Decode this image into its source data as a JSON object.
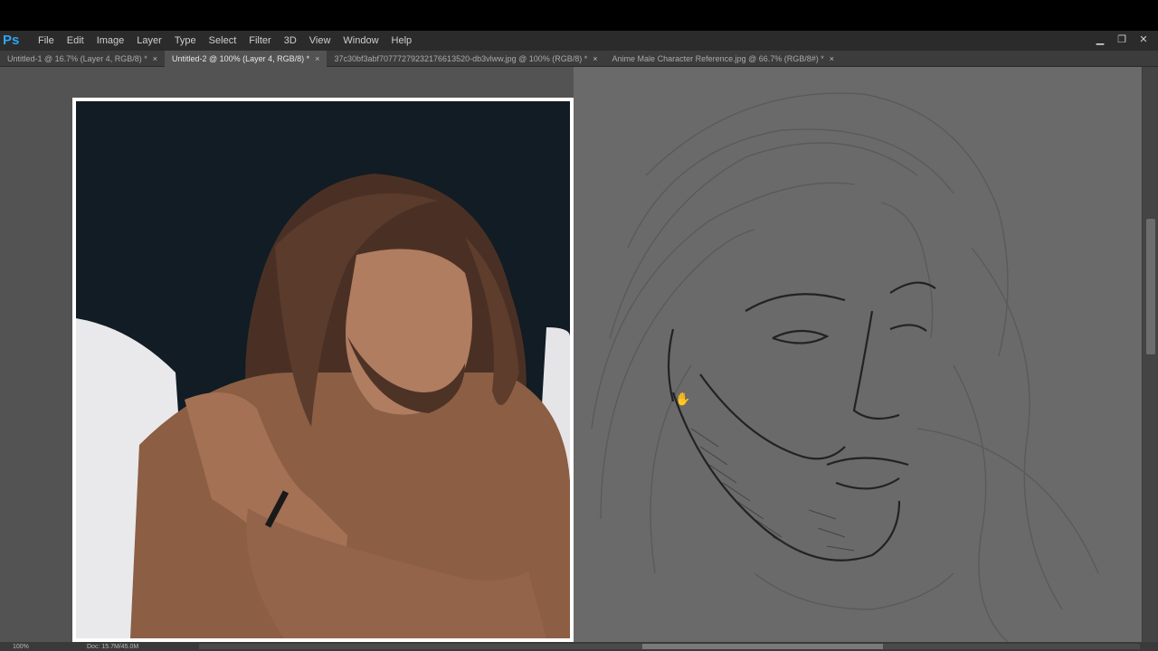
{
  "app": {
    "logo": "Ps"
  },
  "menu": [
    "File",
    "Edit",
    "Image",
    "Layer",
    "Type",
    "Select",
    "Filter",
    "3D",
    "View",
    "Window",
    "Help"
  ],
  "window_controls": {
    "minimize": "▁",
    "restore": "❐",
    "close": "✕"
  },
  "tabs": [
    {
      "label": "Untitled-1 @ 16.7% (Layer 4, RGB/8) *",
      "active": false
    },
    {
      "label": "Untitled-2 @ 100% (Layer 4, RGB/8) *",
      "active": true
    },
    {
      "label": "37c30bf3abf70777279232176613520-db3vlww.jpg @ 100% (RGB/8) *",
      "active": false
    },
    {
      "label": "Anime Male Character Reference.jpg @ 66.7% (RGB/8#) *",
      "active": false
    }
  ],
  "tab_close": "×",
  "status": {
    "zoom": "100%",
    "doc": "Doc: 15.7M/45.0M"
  },
  "colors": {
    "app_bg": "#535353",
    "menubar": "#2b2b2b",
    "tabbar": "#3c3c3c",
    "ps_blue": "#2fa3f7"
  }
}
